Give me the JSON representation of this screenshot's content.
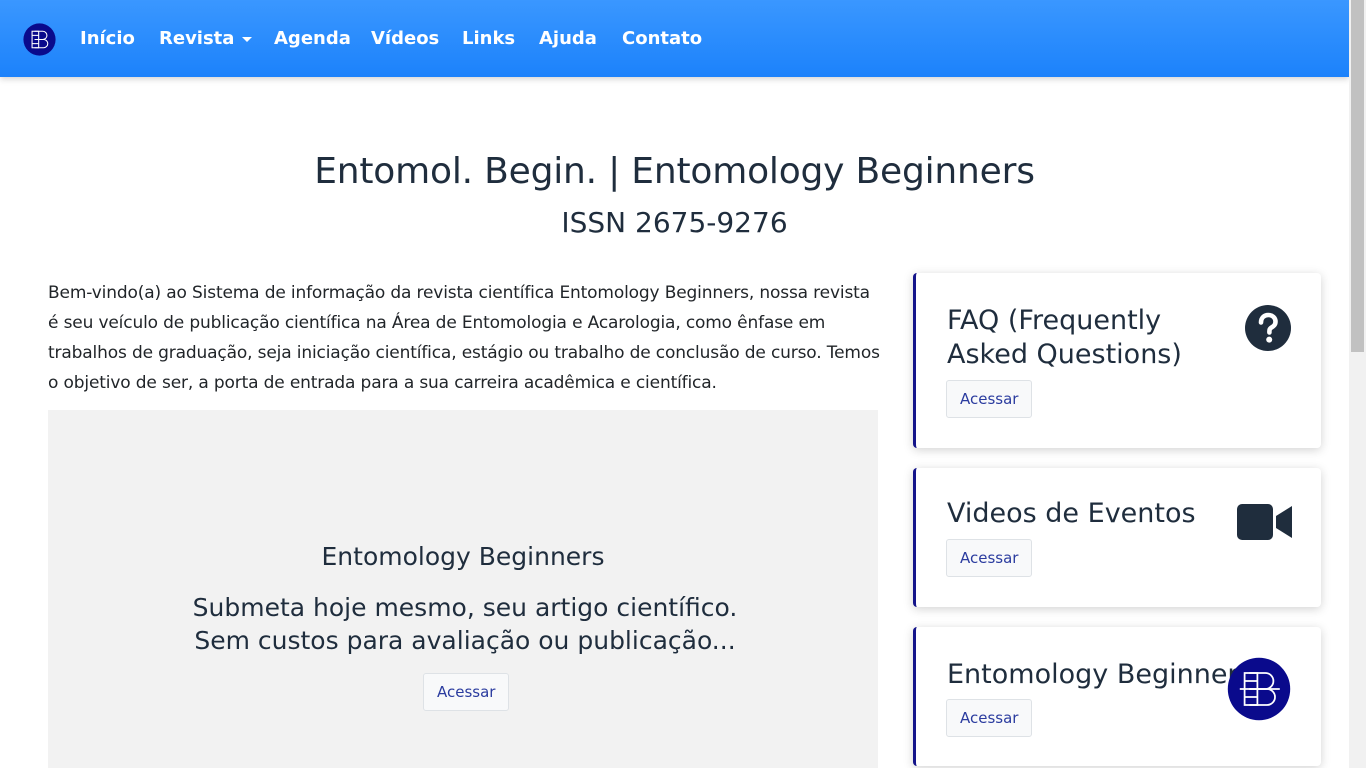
{
  "nav": {
    "brand_icon": "eb-logo-icon",
    "items": [
      {
        "label": "Início"
      },
      {
        "label": "Revista",
        "dropdown": true
      },
      {
        "label": "Agenda"
      },
      {
        "label": "Vídeos"
      },
      {
        "label": "Links"
      },
      {
        "label": "Ajuda"
      },
      {
        "label": "Contato"
      }
    ]
  },
  "header": {
    "title": "Entomol. Begin. | Entomology Beginners",
    "issn": "ISSN 2675-9276"
  },
  "intro": {
    "text": "Bem-vindo(a) ao Sistema de informação da revista científica Entomology Beginners, nossa revista é seu veículo de publicação científica na Área de Entomologia e Acarologia, como ênfase em trabalhos de graduação, seja iniciação científica, estágio ou trabalho de conclusão de curso. Temos o objetivo de ser, a porta de entrada para a sua carreira acadêmica e científica."
  },
  "jumbotron": {
    "heading": "Entomology Beginners",
    "text": "Submeta hoje mesmo, seu artigo científico. Sem custos para avaliação ou publicação...",
    "button": "Acessar"
  },
  "cards": [
    {
      "title": "FAQ (Frequently Asked Questions)",
      "button": "Acessar",
      "icon": "question-circle-icon"
    },
    {
      "title": "Videos de Eventos",
      "button": "Acessar",
      "icon": "video-camera-icon"
    },
    {
      "title": "Entomology Beginners",
      "button": "Acessar",
      "icon": "eb-logo-icon"
    }
  ],
  "colors": {
    "navbar": "#1c82fb",
    "text_dark": "#1f2d3d",
    "card_accent": "#14148a",
    "logo_bg": "#0a0a8c",
    "button_text": "#2b3c9f"
  }
}
